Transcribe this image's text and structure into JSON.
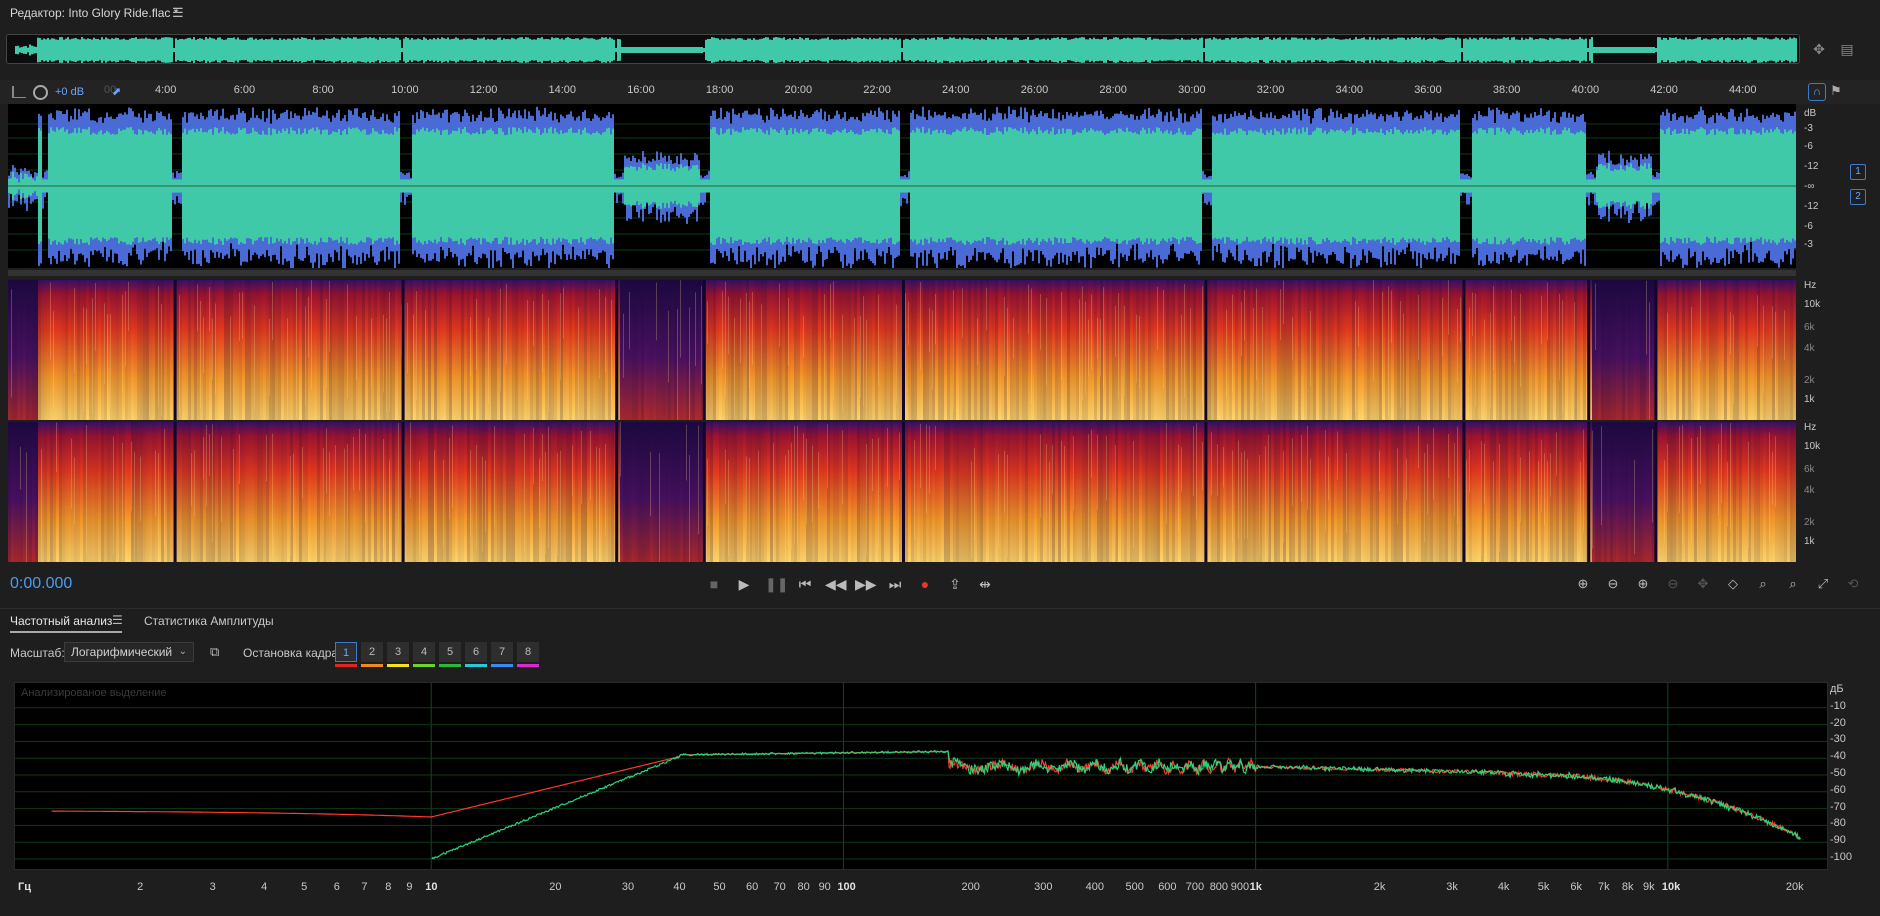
{
  "window": {
    "title": "Редактор: Into Glory Ride.flac *",
    "menu_icon": "hamburger-icon"
  },
  "colors": {
    "waveform": "#40c9a8",
    "waveform_peak": "#4a6bd6",
    "accent": "#4a9cf2",
    "spectral_hot": "#ffd56a",
    "spectral_mid": "#e4381c",
    "spectral_cold": "#2a0d52",
    "fa_left": "#ff3a2a",
    "fa_right": "#2ad47a"
  },
  "ruler": {
    "gain_label": "+0 dB",
    "partial_start": "00",
    "ticks": [
      "4:00",
      "6:00",
      "8:00",
      "10:00",
      "12:00",
      "14:00",
      "16:00",
      "18:00",
      "20:00",
      "22:00",
      "24:00",
      "26:00",
      "28:00",
      "30:00",
      "32:00",
      "34:00",
      "36:00",
      "38:00",
      "40:00",
      "42:00",
      "44:00"
    ]
  },
  "waveform": {
    "db_unit": "dB",
    "db_labels": [
      "-3",
      "-6",
      "-12",
      "-∞",
      "-12",
      "-6",
      "-3"
    ],
    "channels": [
      "1",
      "2"
    ]
  },
  "spectral": {
    "unit": "Hz",
    "labels": [
      "10k",
      "6k",
      "4k",
      "2k",
      "1k"
    ],
    "labels_ch2": [
      "10k",
      "6k",
      "4k",
      "2k",
      "1k"
    ]
  },
  "transport": {
    "timecode": "0:00.000"
  },
  "tabs": {
    "frequency_analysis": "Частотный анализ",
    "amplitude_stats": "Статистика Амплитуды"
  },
  "controls": {
    "scale_label": "Масштаб:",
    "scale_value": "Логарифмический",
    "freeze_label": "Остановка кадра:",
    "frames": [
      "1",
      "2",
      "3",
      "4",
      "5",
      "6",
      "7",
      "8"
    ],
    "frame_colors": [
      "#e3241b",
      "#f08a1c",
      "#f4e21c",
      "#6fd42a",
      "#2ab83a",
      "#25c9d8",
      "#3a8cf0",
      "#d82ad0"
    ]
  },
  "frequency_analysis": {
    "ghost_label": "Анализированое выделение",
    "db_unit": "дБ",
    "db_labels": [
      "-10",
      "-20",
      "-30",
      "-40",
      "-50",
      "-60",
      "-70",
      "-80",
      "-90",
      "-100"
    ],
    "x_labels": [
      {
        "t": "Гц",
        "f": 1.0
      },
      {
        "t": "2",
        "f": 2
      },
      {
        "t": "3",
        "f": 3
      },
      {
        "t": "4",
        "f": 4
      },
      {
        "t": "5",
        "f": 5
      },
      {
        "t": "6",
        "f": 6
      },
      {
        "t": "7",
        "f": 7
      },
      {
        "t": "8",
        "f": 8
      },
      {
        "t": "9",
        "f": 9
      },
      {
        "t": "10",
        "f": 10
      },
      {
        "t": "20",
        "f": 20
      },
      {
        "t": "30",
        "f": 30
      },
      {
        "t": "40",
        "f": 40
      },
      {
        "t": "50",
        "f": 50
      },
      {
        "t": "60",
        "f": 60
      },
      {
        "t": "70",
        "f": 70
      },
      {
        "t": "80",
        "f": 80
      },
      {
        "t": "90",
        "f": 90
      },
      {
        "t": "100",
        "f": 100
      },
      {
        "t": "200",
        "f": 200
      },
      {
        "t": "300",
        "f": 300
      },
      {
        "t": "400",
        "f": 400
      },
      {
        "t": "500",
        "f": 500
      },
      {
        "t": "600",
        "f": 600
      },
      {
        "t": "700",
        "f": 700
      },
      {
        "t": "800",
        "f": 800
      },
      {
        "t": "900",
        "f": 900
      },
      {
        "t": "1k",
        "f": 1000
      },
      {
        "t": "2k",
        "f": 2000
      },
      {
        "t": "3k",
        "f": 3000
      },
      {
        "t": "4k",
        "f": 4000
      },
      {
        "t": "5k",
        "f": 5000
      },
      {
        "t": "6k",
        "f": 6000
      },
      {
        "t": "7k",
        "f": 7000
      },
      {
        "t": "8k",
        "f": 8000
      },
      {
        "t": "9k",
        "f": 9000
      },
      {
        "t": "10k",
        "f": 10000
      },
      {
        "t": "20k",
        "f": 20000
      }
    ]
  }
}
